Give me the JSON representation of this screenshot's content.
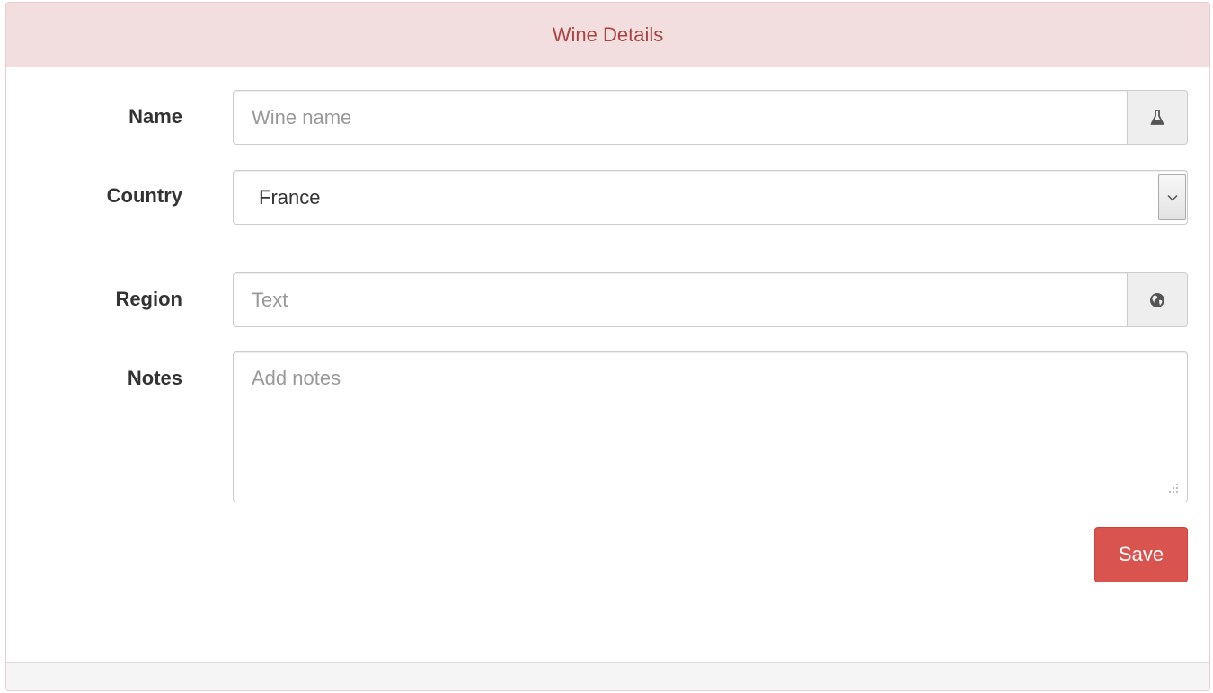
{
  "panel": {
    "title": "Wine Details"
  },
  "form": {
    "name": {
      "label": "Name",
      "placeholder": "Wine name",
      "value": "",
      "addon_icon": "flask-icon"
    },
    "country": {
      "label": "Country",
      "selected": "France",
      "arrow_icon": "chevron-down-icon"
    },
    "region": {
      "label": "Region",
      "placeholder": "Text",
      "value": "",
      "addon_icon": "globe-icon"
    },
    "notes": {
      "label": "Notes",
      "placeholder": "Add notes",
      "value": ""
    },
    "save_label": "Save"
  },
  "colors": {
    "heading_bg": "#f2dede",
    "heading_text": "#a94442",
    "button_bg": "#d9534f",
    "footer_bg": "#f5f5f5"
  }
}
